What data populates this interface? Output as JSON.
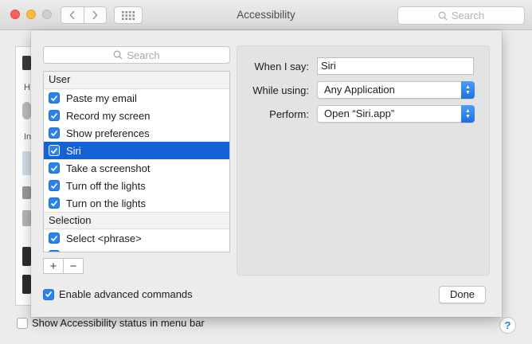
{
  "window": {
    "title": "Accessibility",
    "search_placeholder": "Search"
  },
  "background": {
    "sidebar_letters": [
      "H",
      "In"
    ],
    "show_status_label": "Show Accessibility status in menu bar",
    "help_label": "?"
  },
  "sheet": {
    "search_placeholder": "Search",
    "groups": [
      {
        "header": "User",
        "items": [
          {
            "label": "Paste my email",
            "checked": true,
            "selected": false
          },
          {
            "label": "Record my screen",
            "checked": true,
            "selected": false
          },
          {
            "label": "Show preferences",
            "checked": true,
            "selected": false
          },
          {
            "label": "Siri",
            "checked": true,
            "selected": true
          },
          {
            "label": "Take a screenshot",
            "checked": true,
            "selected": false
          },
          {
            "label": "Turn off the lights",
            "checked": true,
            "selected": false
          },
          {
            "label": "Turn on the lights",
            "checked": true,
            "selected": false
          }
        ]
      },
      {
        "header": "Selection",
        "items": [
          {
            "label": "Select <phrase>",
            "checked": true,
            "selected": false
          }
        ]
      }
    ],
    "add_label": "+",
    "remove_label": "−",
    "advanced_label": "Enable advanced commands",
    "advanced_checked": true,
    "form": {
      "when_label": "When I say:",
      "when_value": "Siri",
      "while_label": "While using:",
      "while_value": "Any Application",
      "perform_label": "Perform:",
      "perform_value": "Open “Siri.app”"
    },
    "done_label": "Done"
  },
  "colors": {
    "selection": "#1462d6",
    "checkbox": "#2a82f0"
  }
}
